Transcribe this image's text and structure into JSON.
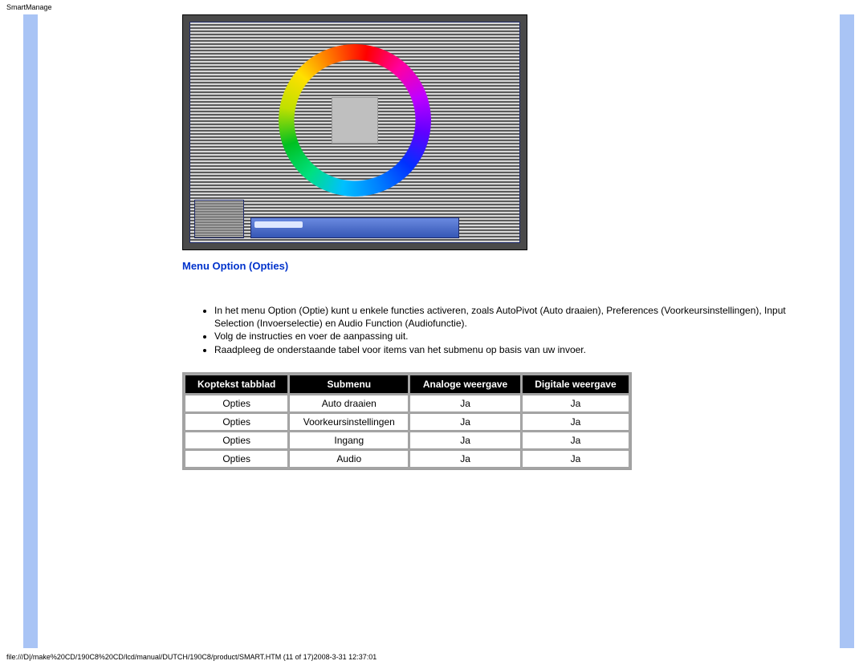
{
  "header": {
    "title": "SmartManage"
  },
  "section": {
    "title": "Menu Option (Opties)"
  },
  "notes": [
    "In het menu Option (Optie) kunt u enkele functies activeren, zoals AutoPivot (Auto draaien), Preferences (Voorkeursinstellingen), Input Selection (Invoerselectie) en Audio Function (Audiofunctie).",
    "Volg de instructies en voer de aanpassing uit.",
    "Raadpleeg de onderstaande tabel voor items van het submenu op basis van uw invoer."
  ],
  "table": {
    "headers": [
      "Koptekst tabblad",
      "Submenu",
      "Analoge weergave",
      "Digitale weergave"
    ],
    "rows": [
      [
        "Opties",
        "Auto draaien",
        "Ja",
        "Ja"
      ],
      [
        "Opties",
        "Voorkeursinstellingen",
        "Ja",
        "Ja"
      ],
      [
        "Opties",
        "Ingang",
        "Ja",
        "Ja"
      ],
      [
        "Opties",
        "Audio",
        "Ja",
        "Ja"
      ]
    ]
  },
  "footer": {
    "path": "file:///D|/make%20CD/190C8%20CD/lcd/manual/DUTCH/190C8/product/SMART.HTM (11 of 17)2008-3-31 12:37:01"
  }
}
